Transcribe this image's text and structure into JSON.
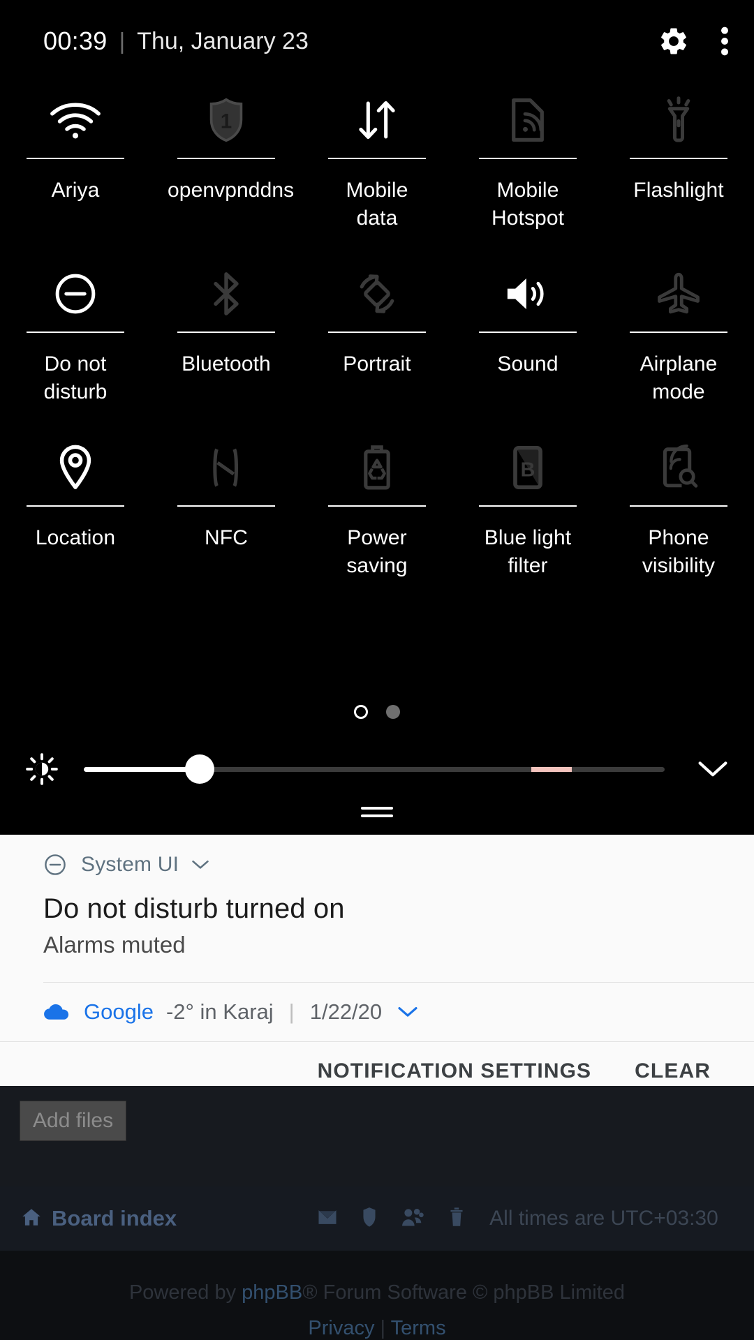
{
  "statusbar": {
    "time": "00:39",
    "separator": "|",
    "date": "Thu, January 23",
    "settings_icon": "gear-icon",
    "overflow_icon": "more-vertical-icon"
  },
  "quick_settings": {
    "tiles": [
      {
        "label": "Ariya",
        "icon": "wifi-icon",
        "state": "on"
      },
      {
        "label": "openvpnddns",
        "icon": "vpn-shield-icon",
        "state": "off"
      },
      {
        "label": "Mobile\ndata",
        "icon": "mobile-data-icon",
        "state": "on"
      },
      {
        "label": "Mobile\nHotspot",
        "icon": "hotspot-icon",
        "state": "off"
      },
      {
        "label": "Flashlight",
        "icon": "flashlight-icon",
        "state": "off"
      },
      {
        "label": "Do not\ndisturb",
        "icon": "do-not-disturb-icon",
        "state": "on"
      },
      {
        "label": "Bluetooth",
        "icon": "bluetooth-icon",
        "state": "off"
      },
      {
        "label": "Portrait",
        "icon": "auto-rotate-icon",
        "state": "off"
      },
      {
        "label": "Sound",
        "icon": "sound-icon",
        "state": "on"
      },
      {
        "label": "Airplane\nmode",
        "icon": "airplane-icon",
        "state": "off"
      },
      {
        "label": "Location",
        "icon": "location-pin-icon",
        "state": "on"
      },
      {
        "label": "NFC",
        "icon": "nfc-icon",
        "state": "off"
      },
      {
        "label": "Power\nsaving",
        "icon": "power-saving-icon",
        "state": "off"
      },
      {
        "label": "Blue light\nfilter",
        "icon": "blue-light-filter-icon",
        "state": "off"
      },
      {
        "label": "Phone\nvisibility",
        "icon": "phone-visibility-icon",
        "state": "off"
      }
    ],
    "pages": {
      "count": 2,
      "current": 1
    },
    "brightness": {
      "icon": "brightness-icon",
      "value_percent": 20,
      "warm_start_percent": 77,
      "warm_end_percent": 84,
      "expand_icon": "chevron-down-icon"
    }
  },
  "notifications": {
    "system_ui": {
      "app_icon": "do-not-disturb-icon",
      "app_name": "System UI",
      "expand_icon": "chevron-down-icon",
      "title": "Do not disturb turned on",
      "body": "Alarms muted"
    },
    "google": {
      "app_icon": "cloud-icon",
      "app_name": "Google",
      "summary": "-2° in Karaj",
      "separator": "|",
      "date": "1/22/20",
      "expand_icon": "chevron-down-icon"
    },
    "actions": {
      "settings_label": "NOTIFICATION SETTINGS",
      "clear_label": "CLEAR"
    }
  },
  "background_app": {
    "add_files_label": "Add files",
    "board_index_label": "Board index",
    "home_icon": "home-icon",
    "nav_icons": [
      "envelope-icon",
      "shield-icon",
      "group-icon",
      "trash-icon"
    ],
    "timezone_text": "All times are UTC+03:30",
    "credit_prefix": "Powered by ",
    "credit_link": "phpBB",
    "credit_suffix": "® Forum Software © phpBB Limited",
    "privacy_label": "Privacy",
    "legal_separator": "|",
    "terms_label": "Terms"
  },
  "colors": {
    "panel_bg": "#000000",
    "shade_bg": "#fafafa",
    "icon_on": "#ffffff",
    "icon_off": "#3a3a3a",
    "accent_blue": "#1a73e8",
    "slider_warm": "#f3c3bd",
    "forum_link": "#4a6080"
  }
}
